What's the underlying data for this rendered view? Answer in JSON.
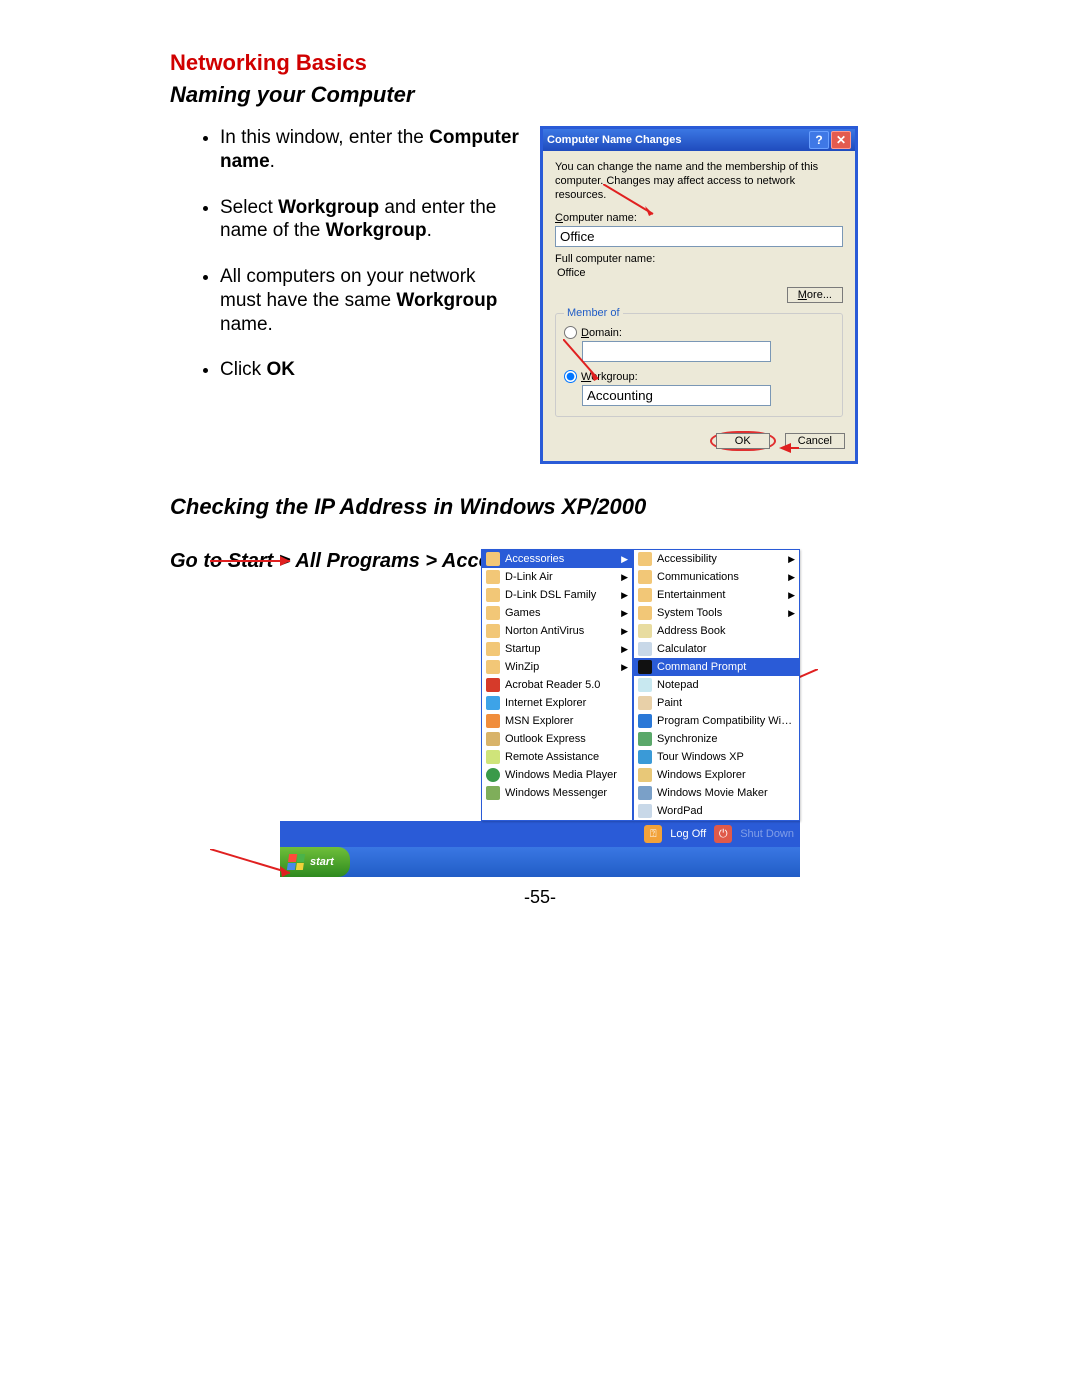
{
  "page": {
    "title": "Networking Basics",
    "subtitle": "Naming your Computer",
    "section2": "Checking the IP Address in Windows XP/2000",
    "nav_line": "Go to Start    > All Programs > Accessories    > Command Prompt",
    "page_number": "-55-"
  },
  "bullets": {
    "b1a": "In this window, enter the ",
    "b1b": "Computer name",
    "b1c": ".",
    "b2a": "Select ",
    "b2b": "Workgroup",
    "b2c": " and enter the name of the ",
    "b2d": "Workgroup",
    "b2e": ".",
    "b3a": "All computers on your network must have the same ",
    "b3b": "Workgroup",
    "b3c": " name.",
    "b4a": "Click ",
    "b4b": "OK"
  },
  "dialog": {
    "title": "Computer Name Changes",
    "help_glyph": "?",
    "close_glyph": "✕",
    "desc": "You can change the name and the membership of this computer. Changes may affect access to network resources.",
    "computer_name_label": "Computer name:",
    "computer_name_value": "Office",
    "full_name_label": "Full computer name:",
    "full_name_value": "Office",
    "more_btn": "More...",
    "member_of": "Member of",
    "domain_label": "Domain:",
    "domain_value": "",
    "workgroup_label": "Workgroup:",
    "workgroup_value": "Accounting",
    "ok_btn": "OK",
    "cancel_btn": "Cancel"
  },
  "start": {
    "left_menu": [
      {
        "label": "Accessories",
        "icon": "folder",
        "submenu": true,
        "hi": true
      },
      {
        "label": "D-Link Air",
        "icon": "folder",
        "submenu": true
      },
      {
        "label": "D-Link DSL Family",
        "icon": "folder",
        "submenu": true
      },
      {
        "label": "Games",
        "icon": "folder",
        "submenu": true
      },
      {
        "label": "Norton AntiVirus",
        "icon": "folder",
        "submenu": true
      },
      {
        "label": "Startup",
        "icon": "folder",
        "submenu": true
      },
      {
        "label": "WinZip",
        "icon": "folder",
        "submenu": true
      },
      {
        "label": "Acrobat Reader 5.0",
        "icon": "pdf",
        "submenu": false
      },
      {
        "label": "Internet Explorer",
        "icon": "ie",
        "submenu": false
      },
      {
        "label": "MSN Explorer",
        "icon": "msn",
        "submenu": false
      },
      {
        "label": "Outlook Express",
        "icon": "oe",
        "submenu": false
      },
      {
        "label": "Remote Assistance",
        "icon": "ra",
        "submenu": false
      },
      {
        "label": "Windows Media Player",
        "icon": "wmp",
        "submenu": false
      },
      {
        "label": "Windows Messenger",
        "icon": "wm",
        "submenu": false
      }
    ],
    "right_menu": [
      {
        "label": "Accessibility",
        "icon": "folder",
        "submenu": true
      },
      {
        "label": "Communications",
        "icon": "folder",
        "submenu": true
      },
      {
        "label": "Entertainment",
        "icon": "folder",
        "submenu": true
      },
      {
        "label": "System Tools",
        "icon": "folder",
        "submenu": true
      },
      {
        "label": "Address Book",
        "icon": "book",
        "submenu": false
      },
      {
        "label": "Calculator",
        "icon": "calc",
        "submenu": false
      },
      {
        "label": "Command Prompt",
        "icon": "cmd",
        "submenu": false,
        "hi": true
      },
      {
        "label": "Notepad",
        "icon": "note",
        "submenu": false
      },
      {
        "label": "Paint",
        "icon": "paint",
        "submenu": false
      },
      {
        "label": "Program Compatibility Wizard",
        "icon": "wiz",
        "submenu": false
      },
      {
        "label": "Synchronize",
        "icon": "sync",
        "submenu": false
      },
      {
        "label": "Tour Windows XP",
        "icon": "tour",
        "submenu": false
      },
      {
        "label": "Windows Explorer",
        "icon": "expl",
        "submenu": false
      },
      {
        "label": "Windows Movie Maker",
        "icon": "mov",
        "submenu": false
      },
      {
        "label": "WordPad",
        "icon": "word",
        "submenu": false
      }
    ],
    "logoff": "Log Off",
    "shutdown": "Shut Down",
    "start_btn": "start"
  }
}
